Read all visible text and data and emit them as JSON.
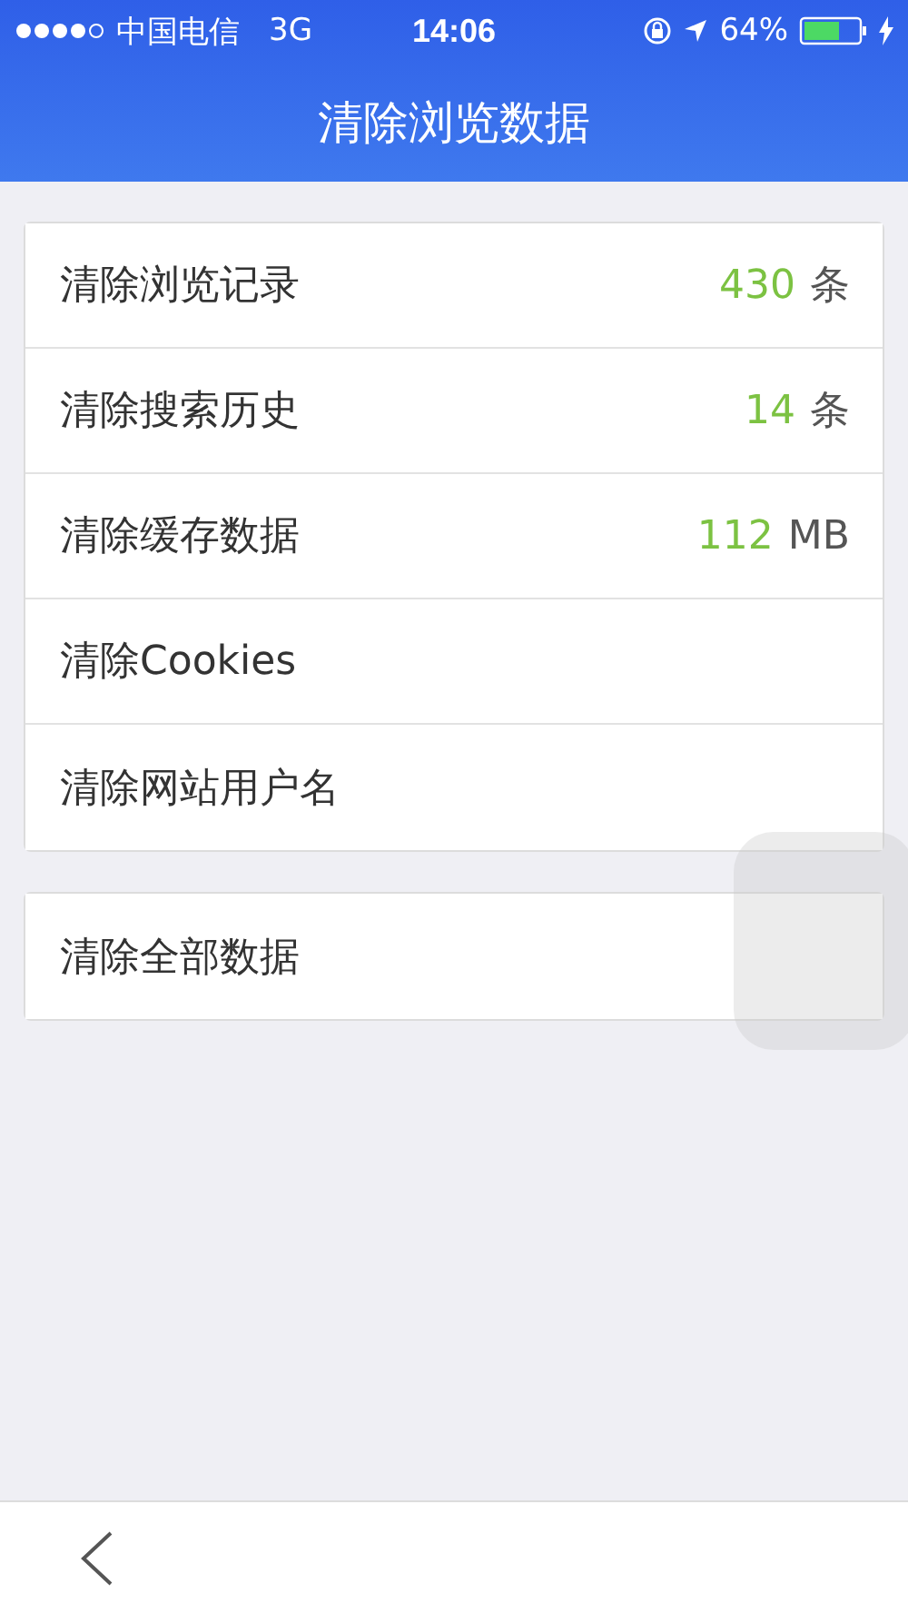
{
  "status_bar": {
    "carrier": "中国电信",
    "network": "3G",
    "time": "14:06",
    "battery": "64%"
  },
  "nav": {
    "title": "清除浏览数据"
  },
  "groups": [
    {
      "rows": [
        {
          "label": "清除浏览记录",
          "count": "430",
          "unit": "条"
        },
        {
          "label": "清除搜索历史",
          "count": "14",
          "unit": "条"
        },
        {
          "label": "清除缓存数据",
          "count": "112",
          "unit": "MB"
        },
        {
          "label": "清除Cookies"
        },
        {
          "label": "清除网站用户名"
        }
      ]
    },
    {
      "rows": [
        {
          "label": "清除全部数据"
        }
      ]
    }
  ]
}
